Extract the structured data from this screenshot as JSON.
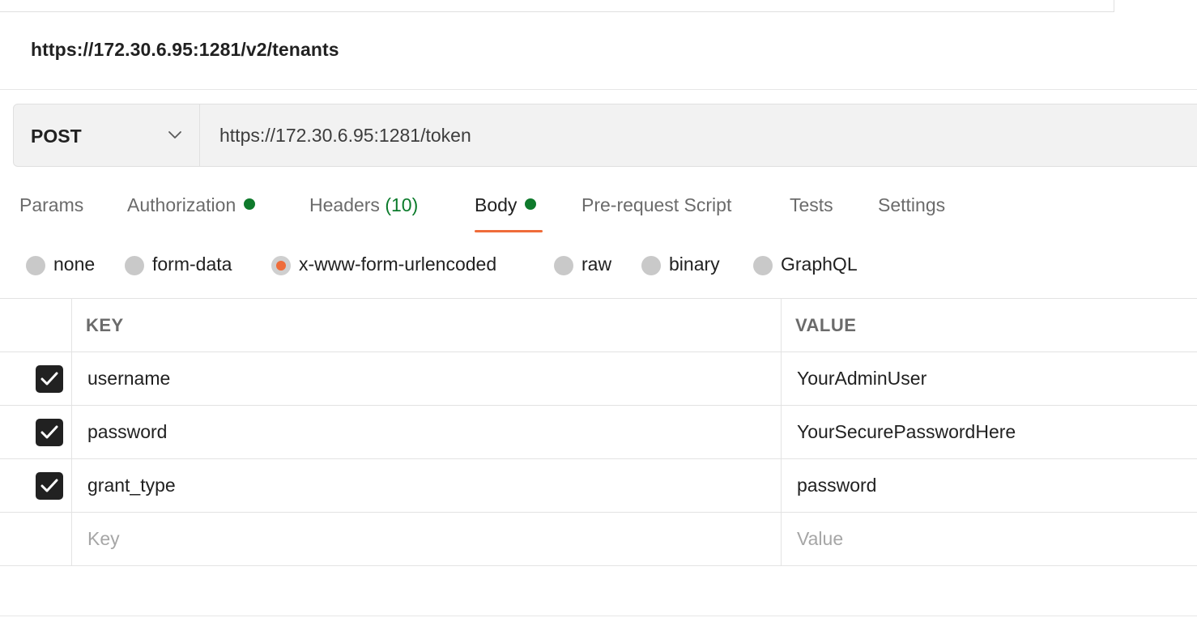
{
  "page": {
    "url_title": "https://172.30.6.95:1281/v2/tenants"
  },
  "request": {
    "method": "POST",
    "url": "https://172.30.6.95:1281/token"
  },
  "tabs": {
    "params": "Params",
    "authorization": "Authorization",
    "headers": "Headers",
    "headers_count": "(10)",
    "body": "Body",
    "prerequest": "Pre-request Script",
    "tests": "Tests",
    "settings": "Settings",
    "active": "Body",
    "indicator_color": "#0f7a2c",
    "active_underline_color": "#ef6c3a"
  },
  "body_types": {
    "options": [
      "none",
      "form-data",
      "x-www-form-urlencoded",
      "raw",
      "binary",
      "GraphQL"
    ],
    "selected": "x-www-form-urlencoded"
  },
  "table": {
    "columns": {
      "key": "KEY",
      "value": "VALUE"
    },
    "rows": [
      {
        "checked": true,
        "key": "username",
        "value": "YourAdminUser"
      },
      {
        "checked": true,
        "key": "password",
        "value": "YourSecurePasswordHere"
      },
      {
        "checked": true,
        "key": "grant_type",
        "value": "password"
      }
    ],
    "new_row": {
      "key_placeholder": "Key",
      "value_placeholder": "Value"
    }
  }
}
